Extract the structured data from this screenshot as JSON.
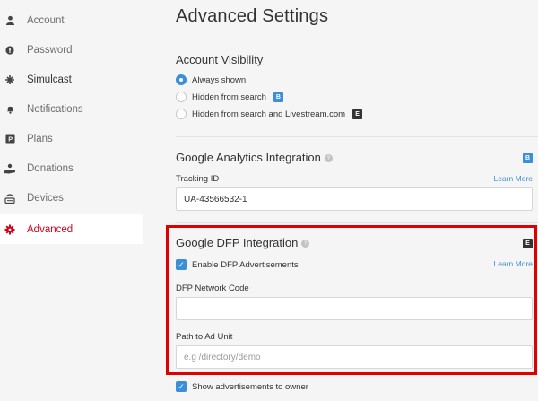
{
  "sidebar": {
    "items": [
      {
        "label": "Account",
        "icon": "user-icon",
        "glyph": "👤"
      },
      {
        "label": "Password",
        "icon": "lock-icon",
        "glyph": "●"
      },
      {
        "label": "Simulcast",
        "icon": "simulcast-icon",
        "glyph": "✣"
      },
      {
        "label": "Notifications",
        "icon": "bell-icon",
        "glyph": "🔔"
      },
      {
        "label": "Plans",
        "icon": "plans-icon",
        "glyph": "P"
      },
      {
        "label": "Donations",
        "icon": "donations-icon",
        "glyph": "🤲"
      },
      {
        "label": "Devices",
        "icon": "devices-icon",
        "glyph": "▤"
      },
      {
        "label": "Advanced",
        "icon": "gear-icon",
        "glyph": "✹"
      }
    ],
    "active_index": 7
  },
  "main": {
    "title": "Advanced Settings",
    "visibility": {
      "title": "Account Visibility",
      "options": [
        {
          "label": "Always shown",
          "checked": true,
          "badge": ""
        },
        {
          "label": "Hidden from search",
          "checked": false,
          "badge": "B"
        },
        {
          "label": "Hidden from search and Livestream.com",
          "checked": false,
          "badge": "E"
        }
      ]
    },
    "analytics": {
      "title": "Google Analytics Integration",
      "help": "?",
      "badge": "B",
      "field_label": "Tracking ID",
      "learn_more": "Learn More",
      "value": "UA-43566532-1"
    },
    "dfp": {
      "title": "Google DFP Integration",
      "help": "?",
      "badge": "E",
      "enable_label": "Enable DFP Advertisements",
      "learn_more": "Learn More",
      "network_code_label": "DFP Network Code",
      "network_code_value": "",
      "path_label": "Path to Ad Unit",
      "path_placeholder": "e.g /directory/demo",
      "show_owner_label": "Show advertisements to owner"
    }
  },
  "colors": {
    "accent": "#3a8fd8",
    "active": "#d0021b",
    "highlight": "#e00000"
  }
}
